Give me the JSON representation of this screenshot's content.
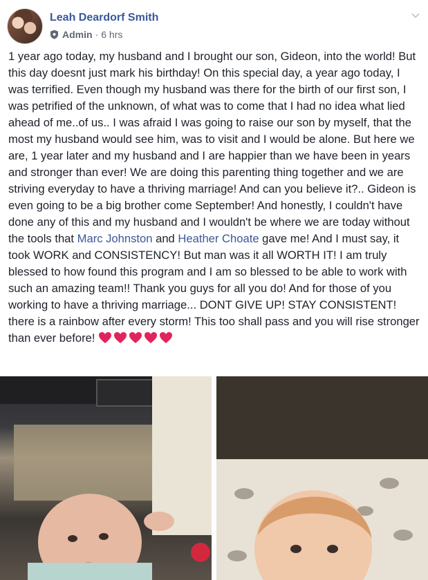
{
  "post": {
    "author_name": "Leah Deardorf Smith",
    "role": "Admin",
    "separator": "·",
    "timestamp": "6 hrs",
    "segments": [
      {
        "text": "1 year ago today, my husband and I brought our son, Gideon, into the world! But this day doesnt just mark his birthday! On this special day, a year ago today, I was terrified. Even though my husband was there for the birth of our first son, I was petrified of the unknown, of what was to come that I had no idea what lied ahead of me..of us.. I was afraid I was going to raise our son by myself, that the most my husband would see him, was to visit and I would be alone. But here we are, 1 year later and my husband and I are happier than we have been in years and stronger than ever! We are doing this parenting thing together and we are striving everyday to have a thriving marriage! And can you believe it?.. Gideon is even going to be a big brother come September! And honestly, I couldn't have done any of this and my husband and I wouldn't be where we are today without the tools that "
      },
      {
        "link": "Marc Johnston"
      },
      {
        "text": " and "
      },
      {
        "link": "Heather Choate"
      },
      {
        "text": " gave me! And I must say, it took WORK and CONSISTENCY! But man was it all WORTH IT! I am truly blessed to how found this program and I am so blessed to be able to work with such an amazing team!! Thank you guys for all you do! And for those of you working to have a thriving marriage... DONT GIVE UP! STAY CONSISTENT! there is a rainbow after every storm! This too shall pass and you will rise stronger than ever before! "
      }
    ],
    "heart_count": 5,
    "photos": [
      {
        "icon": "baby-photo-1"
      },
      {
        "icon": "baby-photo-2"
      }
    ]
  },
  "colors": {
    "link": "#385898",
    "text": "#1d2129",
    "meta": "#606770",
    "heart": "#e0245e"
  }
}
